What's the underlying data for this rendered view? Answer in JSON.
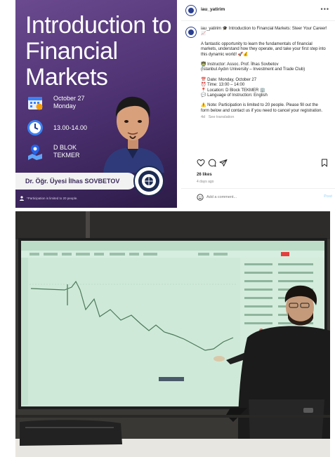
{
  "poster": {
    "title": "Introduction to Financial Markets",
    "event_date": "October 27",
    "event_day": "Monday",
    "event_time": "13.00-14.00",
    "event_location_line1": "D BLOK",
    "event_location_line2": "TEKMER",
    "presenter_name": "Dr. Öğr. Üyesi İlhas SOVBETOV",
    "footnote": "*Participation is limited to 20 people.",
    "colors": {
      "background": "#4a2f6e",
      "text": "#ffffff",
      "name_bar": "#f2f2f2"
    }
  },
  "post": {
    "username": "iau_yatirim",
    "caption": [
      "iau_yatirim 🎓 Introduction to Financial Markets: Steer Your Career! 📈",
      "",
      "A fantastic opportunity to learn the fundamentals of financial",
      "markets, understand how they operate, and take your first step into",
      "this dynamic world! 🚀💰",
      "",
      "👨‍🏫 Instructor: Assoc. Prof. İlhas Sovbetov",
      "(İstanbul Aydın University – Investment and Trade Club)",
      "",
      "📅 Date: Monday, October 27",
      "⏰ Time: 13:00 – 14:00",
      "📍 Location: D Block TEKMER 🏢",
      "💬 Language of Instruction: English",
      "",
      "⚠️ Note: Participation is limited to 20 people. Please fill out the",
      "form below and contact us if you need to cancel your registration."
    ],
    "caption_age": "4d",
    "see_translation": "See translation",
    "likes": "26 likes",
    "posted_ago": "4 days ago",
    "comment_placeholder": "Add a comment...",
    "post_label": "Post",
    "icons": [
      "heart-icon",
      "comment-icon",
      "share-icon",
      "bookmark-icon",
      "emoji-icon",
      "more-icon"
    ]
  },
  "photo": {
    "description_icons": [
      "projector-screen",
      "trading-chart",
      "presenter",
      "laptop"
    ],
    "screen_color": "#cfe9d8"
  }
}
